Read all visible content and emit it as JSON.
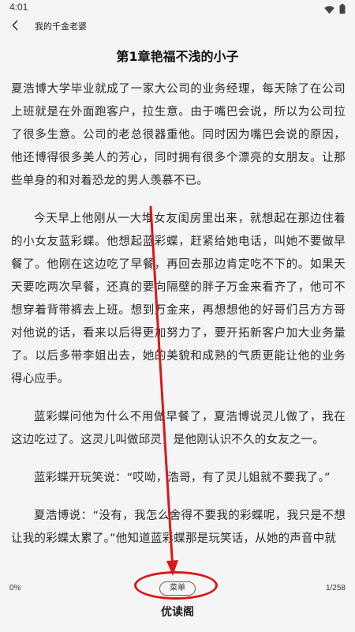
{
  "status": {
    "time": "4:01",
    "icons": [
      "wifi-icon",
      "battery-icon"
    ]
  },
  "header": {
    "back_icon": "chevron-left-icon",
    "book_title": "我的千金老婆"
  },
  "chapter": {
    "title": "第1章艳福不浅的小子"
  },
  "content": {
    "paragraphs": [
      "夏浩博大学毕业就成了一家大公司的业务经理，每天除了在公司上班就是在外面跑客户，拉生意。由于嘴巴会说，所以为公司拉了很多生意。公司的老总很器重他。同时因为嘴巴会说的原因，他还博得很多美人的芳心，同时拥有很多个漂亮的女朋友。让那些单身的和对着恐龙的男人羡慕不已。",
      "今天早上他刚从一大堆女友闺房里出来，就想起在那边住着的小女友蓝彩蝶。他想起蓝彩蝶，赶紧给她电话，叫她不要做早餐了。他刚在这边吃了早餐，再回去那边肯定吃不下的。如果天天要吃两次早餐，还真的要向隔壁的胖子万金来看齐了，他可不想穿着背带裤去上班。想到万金来，再想想他的好哥们吕方方哥对他说的话，看来以后得更加努力了，要开拓新客户加大业务量了。以后多带李姐出去，她的美貌和成熟的气质更能让他的业务得心应手。",
      "蓝彩蝶问他为什么不用做早餐了，夏浩博说灵儿做了，我在这边吃过了。这灵儿叫做邱灵，是他刚认识不久的女友之一。",
      "蓝彩蝶开玩笑说：“哎呦，浩哥，有了灵儿姐就不要我了。”",
      "夏浩博说：“没有，我怎么舍得不要我的彩蝶呢，我只是不想让我的彩蝶太累了。”他知道蓝彩蝶那是玩笑话，从她的声音中就"
    ]
  },
  "footer": {
    "progress": "0%",
    "menu_label": "菜单",
    "page_count": "1/258"
  },
  "watermark": {
    "text": "优读阁"
  },
  "annotation": {
    "color": "#d7191c"
  }
}
